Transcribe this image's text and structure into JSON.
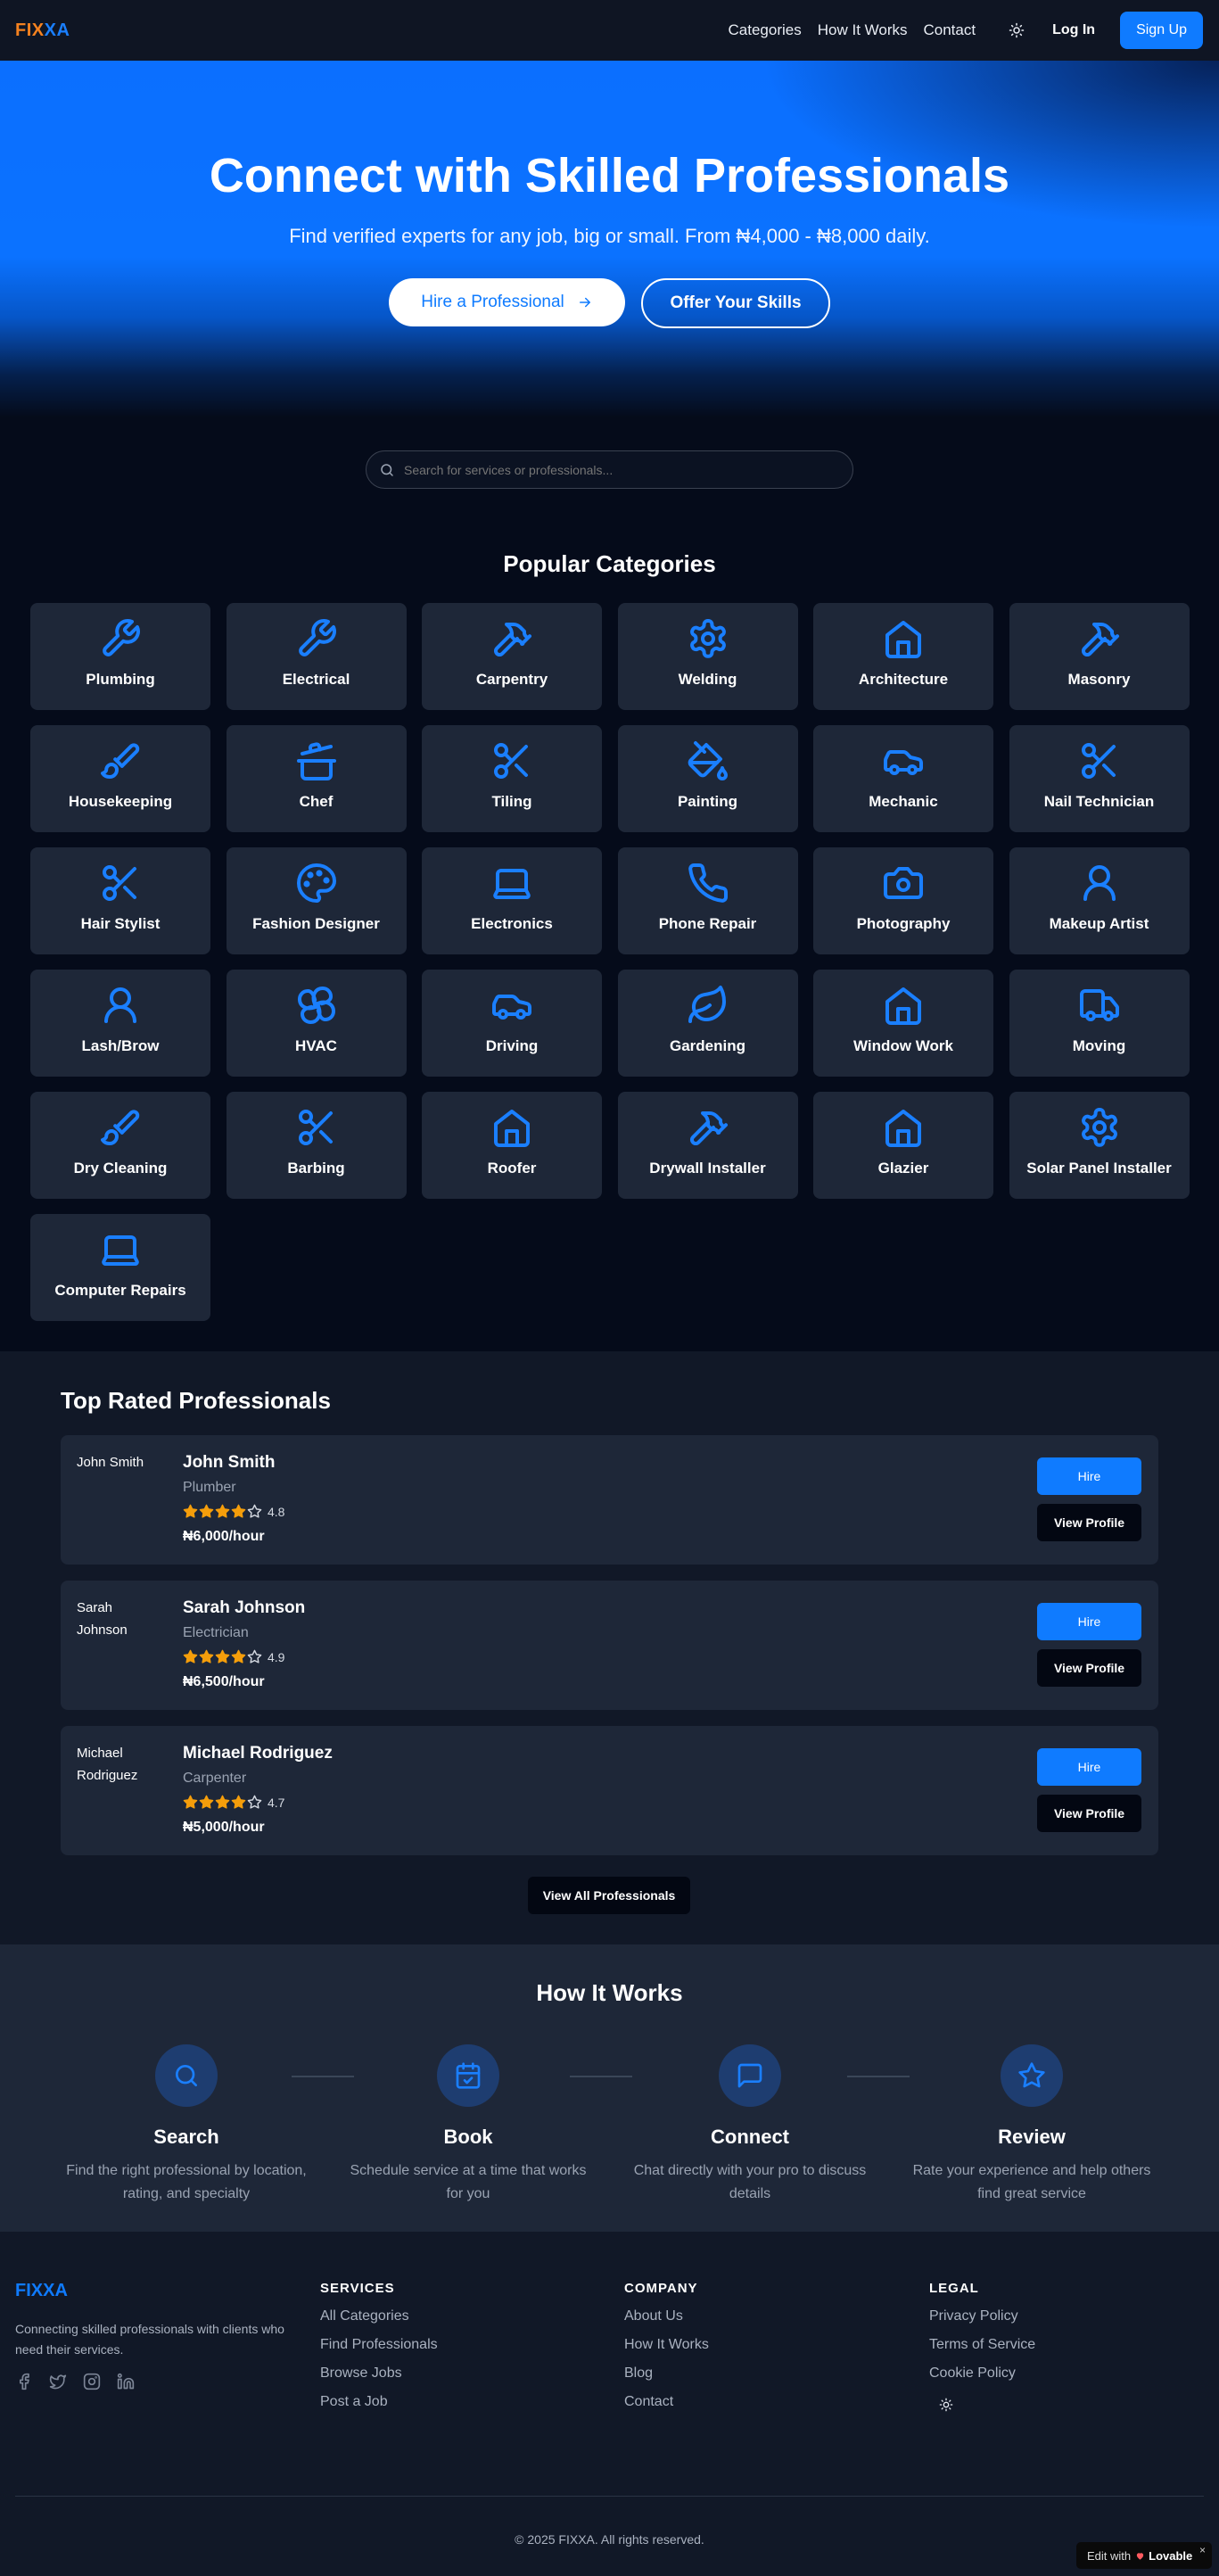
{
  "nav": {
    "logo_part1": "FIX",
    "logo_part2": "XA",
    "links": [
      "Categories",
      "How It Works",
      "Contact"
    ],
    "login": "Log In",
    "signup": "Sign Up",
    "theme_icon": "sun-icon"
  },
  "hero": {
    "title": "Connect with Skilled Professionals",
    "subtitle": "Find verified experts for any job, big or small. From ₦4,000 - ₦8,000 daily.",
    "hire_button": "Hire a Professional",
    "offer_button": "Offer Your Skills"
  },
  "search": {
    "placeholder": "Search for services or professionals..."
  },
  "categories": {
    "title": "Popular Categories",
    "items": [
      {
        "label": "Plumbing",
        "icon": "wrench-icon"
      },
      {
        "label": "Electrical",
        "icon": "wrench-icon"
      },
      {
        "label": "Carpentry",
        "icon": "hammer-icon"
      },
      {
        "label": "Welding",
        "icon": "gear-icon"
      },
      {
        "label": "Architecture",
        "icon": "house-icon"
      },
      {
        "label": "Masonry",
        "icon": "hammer-icon"
      },
      {
        "label": "Housekeeping",
        "icon": "brush-icon"
      },
      {
        "label": "Chef",
        "icon": "cooking-pot-icon"
      },
      {
        "label": "Tiling",
        "icon": "scissors-icon"
      },
      {
        "label": "Painting",
        "icon": "paint-bucket-icon"
      },
      {
        "label": "Mechanic",
        "icon": "car-icon"
      },
      {
        "label": "Nail Technician",
        "icon": "scissors-icon"
      },
      {
        "label": "Hair Stylist",
        "icon": "scissors-icon"
      },
      {
        "label": "Fashion Designer",
        "icon": "palette-icon"
      },
      {
        "label": "Electronics",
        "icon": "laptop-icon"
      },
      {
        "label": "Phone Repair",
        "icon": "phone-icon"
      },
      {
        "label": "Photography",
        "icon": "camera-icon"
      },
      {
        "label": "Makeup Artist",
        "icon": "user-icon"
      },
      {
        "label": "Lash/Brow",
        "icon": "user-icon"
      },
      {
        "label": "HVAC",
        "icon": "fan-icon"
      },
      {
        "label": "Driving",
        "icon": "car-icon"
      },
      {
        "label": "Gardening",
        "icon": "leaf-icon"
      },
      {
        "label": "Window Work",
        "icon": "house-icon"
      },
      {
        "label": "Moving",
        "icon": "truck-icon"
      },
      {
        "label": "Dry Cleaning",
        "icon": "brush-icon"
      },
      {
        "label": "Barbing",
        "icon": "scissors-icon"
      },
      {
        "label": "Roofer",
        "icon": "house-icon"
      },
      {
        "label": "Drywall Installer",
        "icon": "hammer-icon"
      },
      {
        "label": "Glazier",
        "icon": "house-icon"
      },
      {
        "label": "Solar Panel Installer",
        "icon": "gear-icon"
      },
      {
        "label": "Computer Repairs",
        "icon": "laptop-icon"
      }
    ]
  },
  "professionals": {
    "title": "Top Rated Professionals",
    "items": [
      {
        "avatar_alt": "John Smith",
        "name": "John Smith",
        "trade": "Plumber",
        "rating": "4.8",
        "stars": 4,
        "rate": "₦6,000/hour"
      },
      {
        "avatar_alt": "Sarah Johnson",
        "name": "Sarah Johnson",
        "trade": "Electrician",
        "rating": "4.9",
        "stars": 4,
        "rate": "₦6,500/hour"
      },
      {
        "avatar_alt": "Michael Rodriguez",
        "name": "Michael Rodriguez",
        "trade": "Carpenter",
        "rating": "4.7",
        "stars": 4,
        "rate": "₦5,000/hour"
      }
    ],
    "hire_label": "Hire",
    "view_label": "View Profile",
    "view_all": "View All Professionals"
  },
  "how": {
    "title": "How It Works",
    "steps": [
      {
        "title": "Search",
        "desc": "Find the right professional by location, rating, and specialty",
        "icon": "search-icon"
      },
      {
        "title": "Book",
        "desc": "Schedule service at a time that works for you",
        "icon": "calendar-check-icon"
      },
      {
        "title": "Connect",
        "desc": "Chat directly with your pro to discuss details",
        "icon": "message-icon"
      },
      {
        "title": "Review",
        "desc": "Rate your experience and help others find great service",
        "icon": "star-icon"
      }
    ]
  },
  "footer": {
    "logo": "FIXXA",
    "desc": "Connecting skilled professionals with clients who need their services.",
    "services": {
      "title": "SERVICES",
      "items": [
        "All Categories",
        "Find Professionals",
        "Browse Jobs",
        "Post a Job"
      ]
    },
    "company": {
      "title": "COMPANY",
      "items": [
        "About Us",
        "How It Works",
        "Blog",
        "Contact"
      ]
    },
    "legal": {
      "title": "LEGAL",
      "items": [
        "Privacy Policy",
        "Terms of Service",
        "Cookie Policy"
      ]
    },
    "copyright": "© 2025 FIXXA. All rights reserved.",
    "badge_prefix": "Edit with",
    "badge_brand": "Lovable",
    "badge_close": "×"
  },
  "colors": {
    "accent": "#0f7bff",
    "logo_orange": "#f5821f",
    "star": "#f59e0b",
    "card": "#1e2738",
    "background": "#050b1a"
  }
}
